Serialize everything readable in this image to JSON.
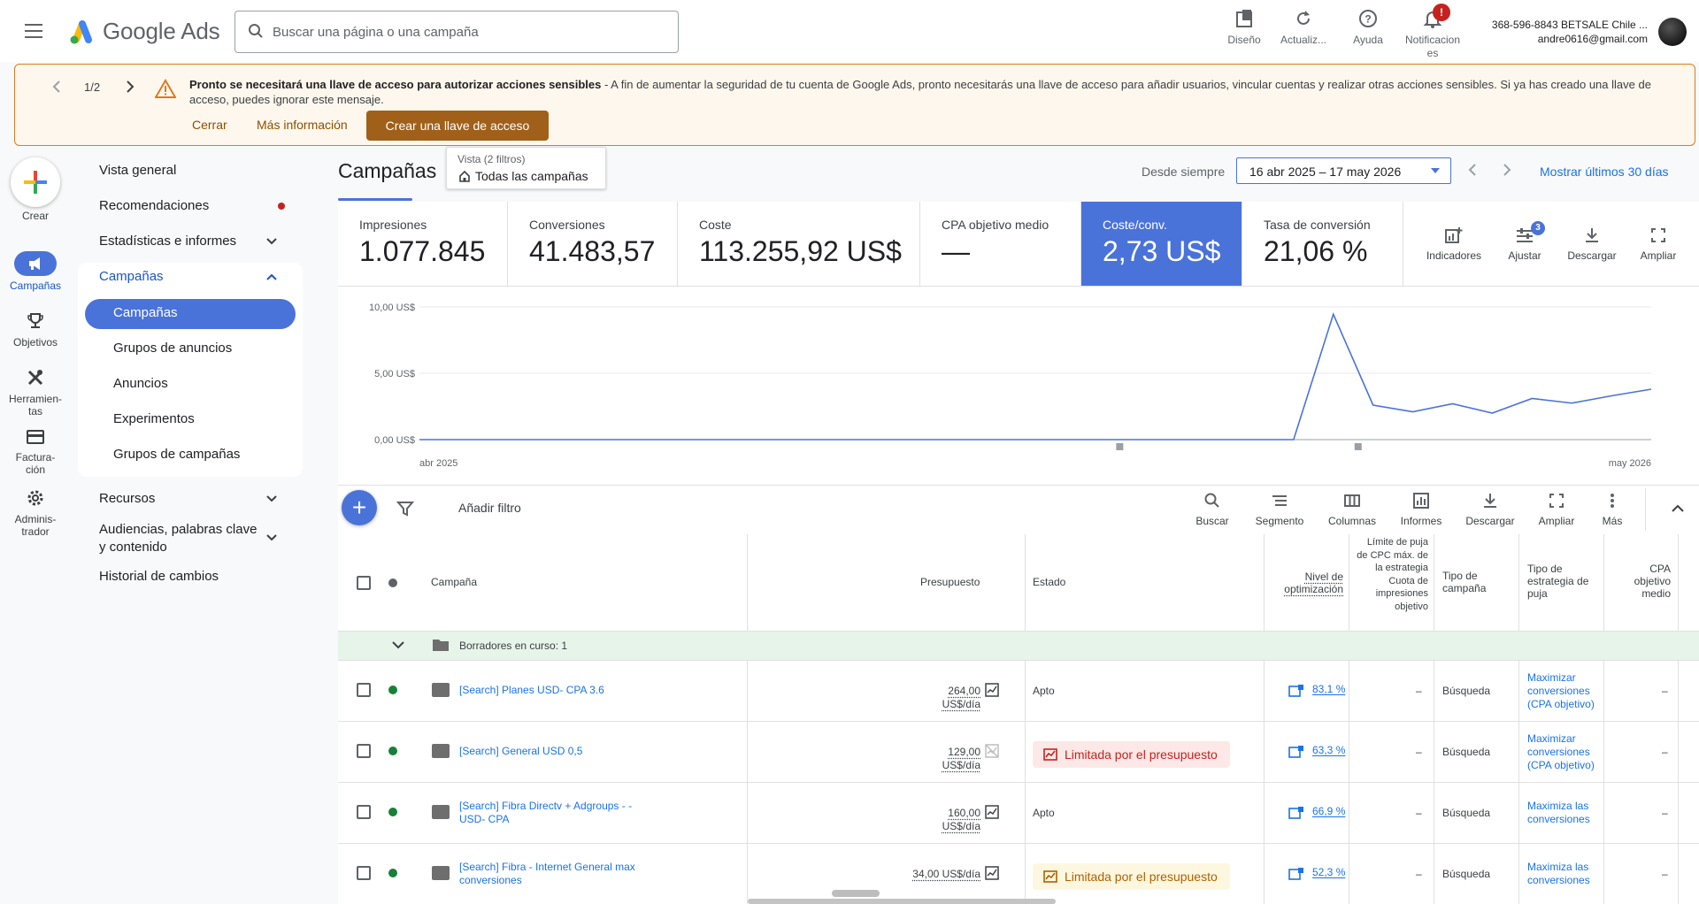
{
  "header": {
    "logo_text": "Google Ads",
    "search_placeholder": "Buscar una página o una campaña",
    "actions": [
      {
        "label": "Diseño",
        "icon": "layout-icon"
      },
      {
        "label": "Actualiz...",
        "icon": "refresh-icon"
      },
      {
        "label": "Ayuda",
        "icon": "help-icon"
      },
      {
        "label": "Notificacion",
        "label2": "es",
        "icon": "bell-icon",
        "badge": "!"
      }
    ],
    "account_line1": "368-596-8843 BETSALE Chile ...",
    "account_line2": "andre0616@gmail.com"
  },
  "banner": {
    "page": "1/2",
    "title": "Pronto se necesitará una llave de acceso para autorizar acciones sensibles",
    "text": " - A fin de aumentar la seguridad de tu cuenta de Google Ads, pronto necesitarás una llave de acceso para añadir usuarios, vincular cuentas y realizar otras acciones sensibles. Si ya has creado una llave de acceso, puedes ignorar este mensaje.",
    "close": "Cerrar",
    "more_info": "Más información",
    "create_key": "Crear una llave de acceso"
  },
  "rail": {
    "create": "Crear",
    "campaigns": "Campañas",
    "goals": "Objetivos",
    "tools1": "Herramien-",
    "tools2": "tas",
    "billing1": "Factura-",
    "billing2": "ción",
    "admin1": "Adminis-",
    "admin2": "trador"
  },
  "nav": {
    "overview": "Vista general",
    "recommendations": "Recomendaciones",
    "stats": "Estadísticas e informes",
    "campaigns_group": "Campañas",
    "campaigns": "Campañas",
    "ad_groups": "Grupos de anuncios",
    "ads": "Anuncios",
    "experiments": "Experimentos",
    "campaign_groups": "Grupos de campañas",
    "resources": "Recursos",
    "audiences1": "Audiencias, palabras clave",
    "audiences2": "y contenido",
    "history": "Historial de cambios"
  },
  "main": {
    "title": "Campañas",
    "view_label": "Vista (2 filtros)",
    "view_value": "Todas las campañas",
    "date_label": "Desde siempre",
    "date_range": "16 abr 2025 – 17 may 2026",
    "last30": "Mostrar últimos 30 días"
  },
  "metrics": [
    {
      "label": "Impresiones",
      "value": "1.077.845"
    },
    {
      "label": "Conversiones",
      "value": "41.483,57"
    },
    {
      "label": "Coste",
      "value": "113.255,92 US$"
    },
    {
      "label": "CPA objetivo medio",
      "value": "—"
    },
    {
      "label": "Coste/conv.",
      "value": "2,73 US$"
    },
    {
      "label": "Tasa de conversión",
      "value": "21,06 %"
    }
  ],
  "metric_tools": {
    "indicators": "Indicadores",
    "adjust": "Ajustar",
    "adjust_badge": "3",
    "download": "Descargar",
    "expand": "Ampliar"
  },
  "chart_data": {
    "type": "line",
    "series": [
      {
        "name": "Coste/conv.",
        "values": [
          0,
          0,
          0,
          0,
          0,
          0,
          0,
          0,
          0,
          0,
          0,
          0,
          0,
          0,
          0,
          0,
          0,
          0,
          0,
          0,
          0,
          0,
          0,
          9.45,
          2.6,
          2.1,
          2.7,
          2.0,
          3.1,
          2.75,
          3.3,
          3.8
        ]
      }
    ],
    "y_ticks": [
      "10,00 US$",
      "5,00 US$",
      "0,00 US$"
    ],
    "ylim": [
      0,
      10
    ],
    "x_start": "abr 2025",
    "x_end": "may 2026",
    "color": "#4a73d9",
    "grid": true
  },
  "table_toolbar": {
    "add_filter": "Añadir filtro",
    "search": "Buscar",
    "segment": "Segmento",
    "columns": "Columnas",
    "reports": "Informes",
    "download": "Descargar",
    "expand": "Ampliar",
    "more": "Más"
  },
  "table": {
    "headers": {
      "campaign": "Campaña",
      "budget": "Presupuesto",
      "status": "Estado",
      "opt1": "Nivel de",
      "opt2": "optimización",
      "cpc": "Límite de puja de CPC máx. de la estrategia Cuota de impresiones objetivo",
      "type": "Tipo de campaña",
      "strategy": "Tipo de estrategia de puja",
      "cpa": "CPA objetivo medio"
    },
    "draft": "Borradores en curso: 1",
    "rows": [
      {
        "name": "[Search] Planes USD- CPA 3.6",
        "budget": "264,00 US$/día",
        "status": "Apto",
        "opt": "83,1 %",
        "cpc": "–",
        "type": "Búsqueda",
        "strategy": "Maximizar conversiones (CPA objetivo)",
        "cpa": "–"
      },
      {
        "name": "[Search] General USD 0,5",
        "budget": "129,00 US$/día",
        "status": "Limitada por el presupuesto",
        "opt": "63,3 %",
        "cpc": "–",
        "type": "Búsqueda",
        "strategy": "Maximizar conversiones (CPA objetivo)",
        "cpa": "–"
      },
      {
        "name": "[Search] Fibra Directv + Adgroups - - USD- CPA",
        "budget": "160,00 US$/día",
        "status": "Apto",
        "opt": "66,9 %",
        "cpc": "–",
        "type": "Búsqueda",
        "strategy": "Maximiza las conversiones",
        "cpa": "–"
      },
      {
        "name": "[Search] Fibra - Internet General  max conversiones",
        "budget": "34,00 US$/día",
        "status": "Limitada por el presupuesto",
        "opt": "52,3 %",
        "cpc": "–",
        "type": "Búsqueda",
        "strategy": "Maximiza las conversiones",
        "cpa": "–"
      }
    ]
  }
}
